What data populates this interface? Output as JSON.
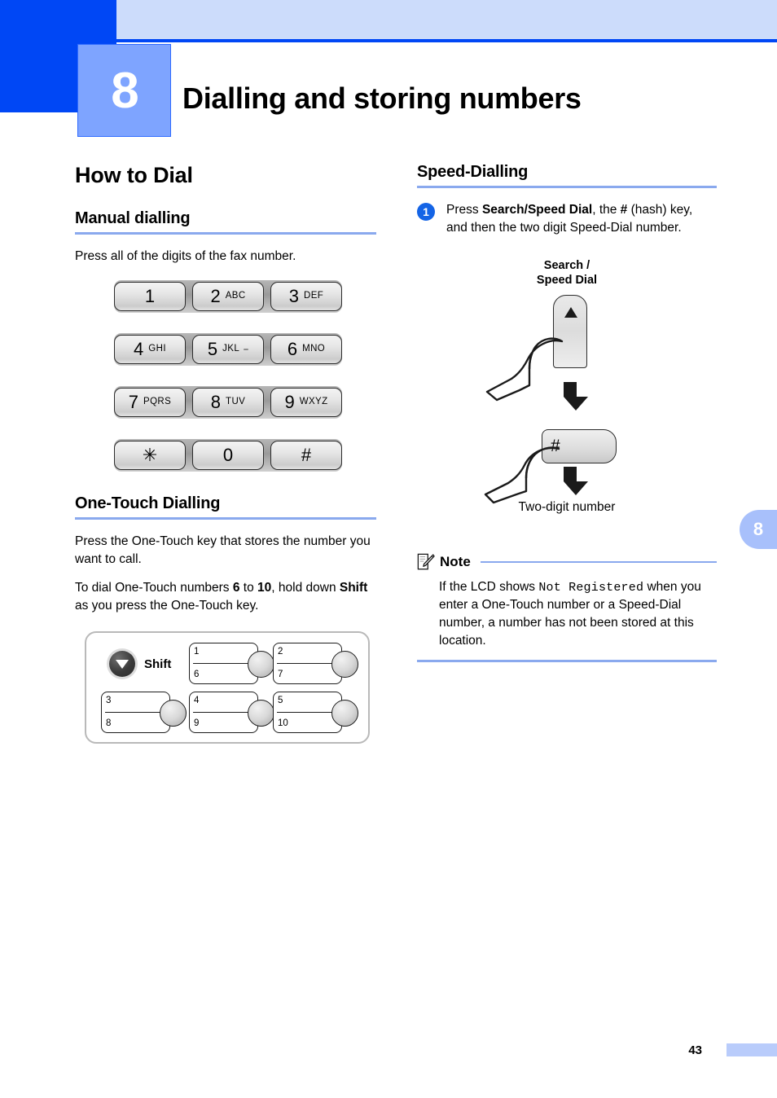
{
  "header": {
    "chapter_number": "8",
    "chapter_title": "Dialling and storing numbers"
  },
  "side_tab": {
    "label": "8"
  },
  "footer": {
    "page_number": "43"
  },
  "left_column": {
    "section_title": "How to Dial",
    "manual": {
      "heading": "Manual dialling",
      "paragraph": "Press all of the digits of the fax number."
    },
    "dialpad": {
      "rows": [
        [
          {
            "num": "1",
            "letters": ""
          },
          {
            "num": "2",
            "letters": "ABC"
          },
          {
            "num": "3",
            "letters": "DEF"
          }
        ],
        [
          {
            "num": "4",
            "letters": "GHI"
          },
          {
            "num": "5",
            "letters": "JKL",
            "tactile": true
          },
          {
            "num": "6",
            "letters": "MNO"
          }
        ],
        [
          {
            "num": "7",
            "letters": "PQRS"
          },
          {
            "num": "8",
            "letters": "TUV"
          },
          {
            "num": "9",
            "letters": "WXYZ"
          }
        ],
        [
          {
            "num": "✳",
            "letters": ""
          },
          {
            "num": "0",
            "letters": ""
          },
          {
            "num": "#",
            "letters": ""
          }
        ]
      ]
    },
    "one_touch": {
      "heading": "One-Touch Dialling",
      "paragraph_1": "Press the One-Touch key that stores the number you want to call.",
      "paragraph_2_part1": "To dial One-Touch numbers ",
      "paragraph_2_bold1": "6",
      "paragraph_2_part2": " to ",
      "paragraph_2_bold2": "10",
      "paragraph_2_part3": ", hold down ",
      "paragraph_2_bold3": "Shift",
      "paragraph_2_part4": " as you press the One-Touch key.",
      "panel": {
        "shift_label": "Shift",
        "keys": [
          {
            "top": "1",
            "bottom": "6"
          },
          {
            "top": "2",
            "bottom": "7"
          },
          {
            "top": "3",
            "bottom": "8"
          },
          {
            "top": "4",
            "bottom": "9"
          },
          {
            "top": "5",
            "bottom": "10"
          }
        ]
      }
    }
  },
  "right_column": {
    "section_title": "Speed-Dialling",
    "step_1": {
      "badge": "1",
      "text_part1": "Press ",
      "text_bold1": "Search/Speed Dial",
      "text_part2": ", the ",
      "text_bold2": "#",
      "text_part3": " (hash) key, and then the two digit Speed-Dial number."
    },
    "figure": {
      "caption_top_line1": "Search /",
      "caption_top_line2": "Speed Dial",
      "hash_key_label": "#",
      "caption_bottom": "Two-digit number"
    },
    "note": {
      "title": "Note",
      "text_part1": "If the LCD shows ",
      "mono_text": "Not Registered",
      "text_part2": " when you enter a One-Touch number or a Speed-Dial number, a number has not been stored at this location."
    }
  },
  "colors": {
    "chapter_dark_blue": "#0047f5",
    "chapter_light_band": "#ccdcfb",
    "chapter_box_blue": "#7ea4ff",
    "heading_rule": "#8aa9ee",
    "step_badge": "#1464e6",
    "side_tab": "#a8c0fb"
  }
}
